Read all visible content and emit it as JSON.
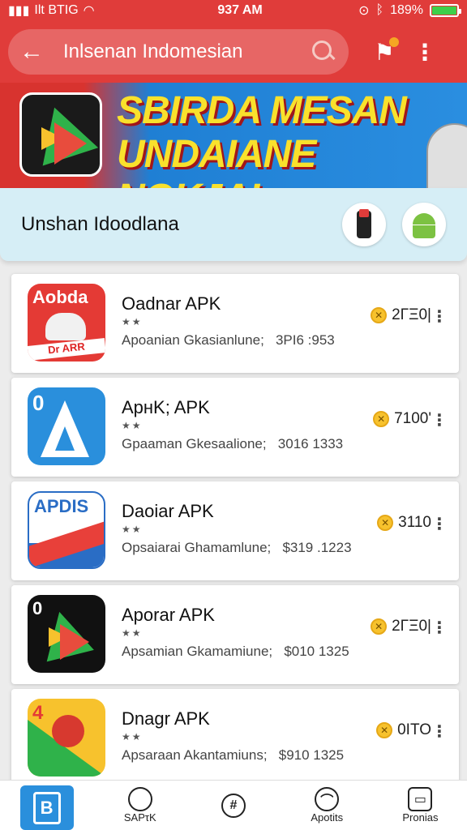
{
  "status_bar": {
    "carrier": "Ilt BTIG",
    "time": "937 AM",
    "battery": "189%",
    "battery_fill": 1.0
  },
  "toolbar": {
    "search_text": "Inlsenan Indomesian"
  },
  "banner": {
    "line1": "SBIRDA MESAN",
    "line2": "UNDAIANE NOKJAI"
  },
  "section": {
    "title": "Unshan Idoodlana"
  },
  "apps": [
    {
      "name": "Oadnar APK",
      "rating": "★★",
      "desc": "Apoanian Gkasianlune;",
      "version": "3PI6 :953",
      "count": "2ΓΞ0|",
      "icon_label": "Aobda"
    },
    {
      "name": "ApнK; APK",
      "rating": "★★",
      "desc": "Gpaaman Gkesaalione;",
      "version": "3016 1333",
      "count": "7100'",
      "icon_label": "0"
    },
    {
      "name": "Daoiar APK",
      "rating": "★★",
      "desc": "Opsaiarai Ghamamlune;",
      "version": "$319 .1223",
      "count": "3110",
      "icon_label": "APDIS"
    },
    {
      "name": "Aporar APK",
      "rating": "★★",
      "desc": "Apsamian Gkamamiune;",
      "version": "$010 1325",
      "count": "2ΓΞ0|",
      "icon_label": "0"
    },
    {
      "name": "Dnagr APK",
      "rating": "★★",
      "desc": "Apsaraan Akantamiuns;",
      "version": "$910 1325",
      "count": "0ITO",
      "icon_label": "4"
    }
  ],
  "bottom_nav": [
    {
      "label": "",
      "icon": "app-box-icon"
    },
    {
      "label": "SAPτK",
      "icon": "circle-icon"
    },
    {
      "label": "",
      "icon": "hash-icon"
    },
    {
      "label": "Apotits",
      "icon": "user-icon"
    },
    {
      "label": "Pronias",
      "icon": "printer-icon"
    }
  ],
  "colors": {
    "primary": "#e03c3a",
    "accent_blue": "#2a8fdc",
    "section_bg": "#d6eef6"
  }
}
